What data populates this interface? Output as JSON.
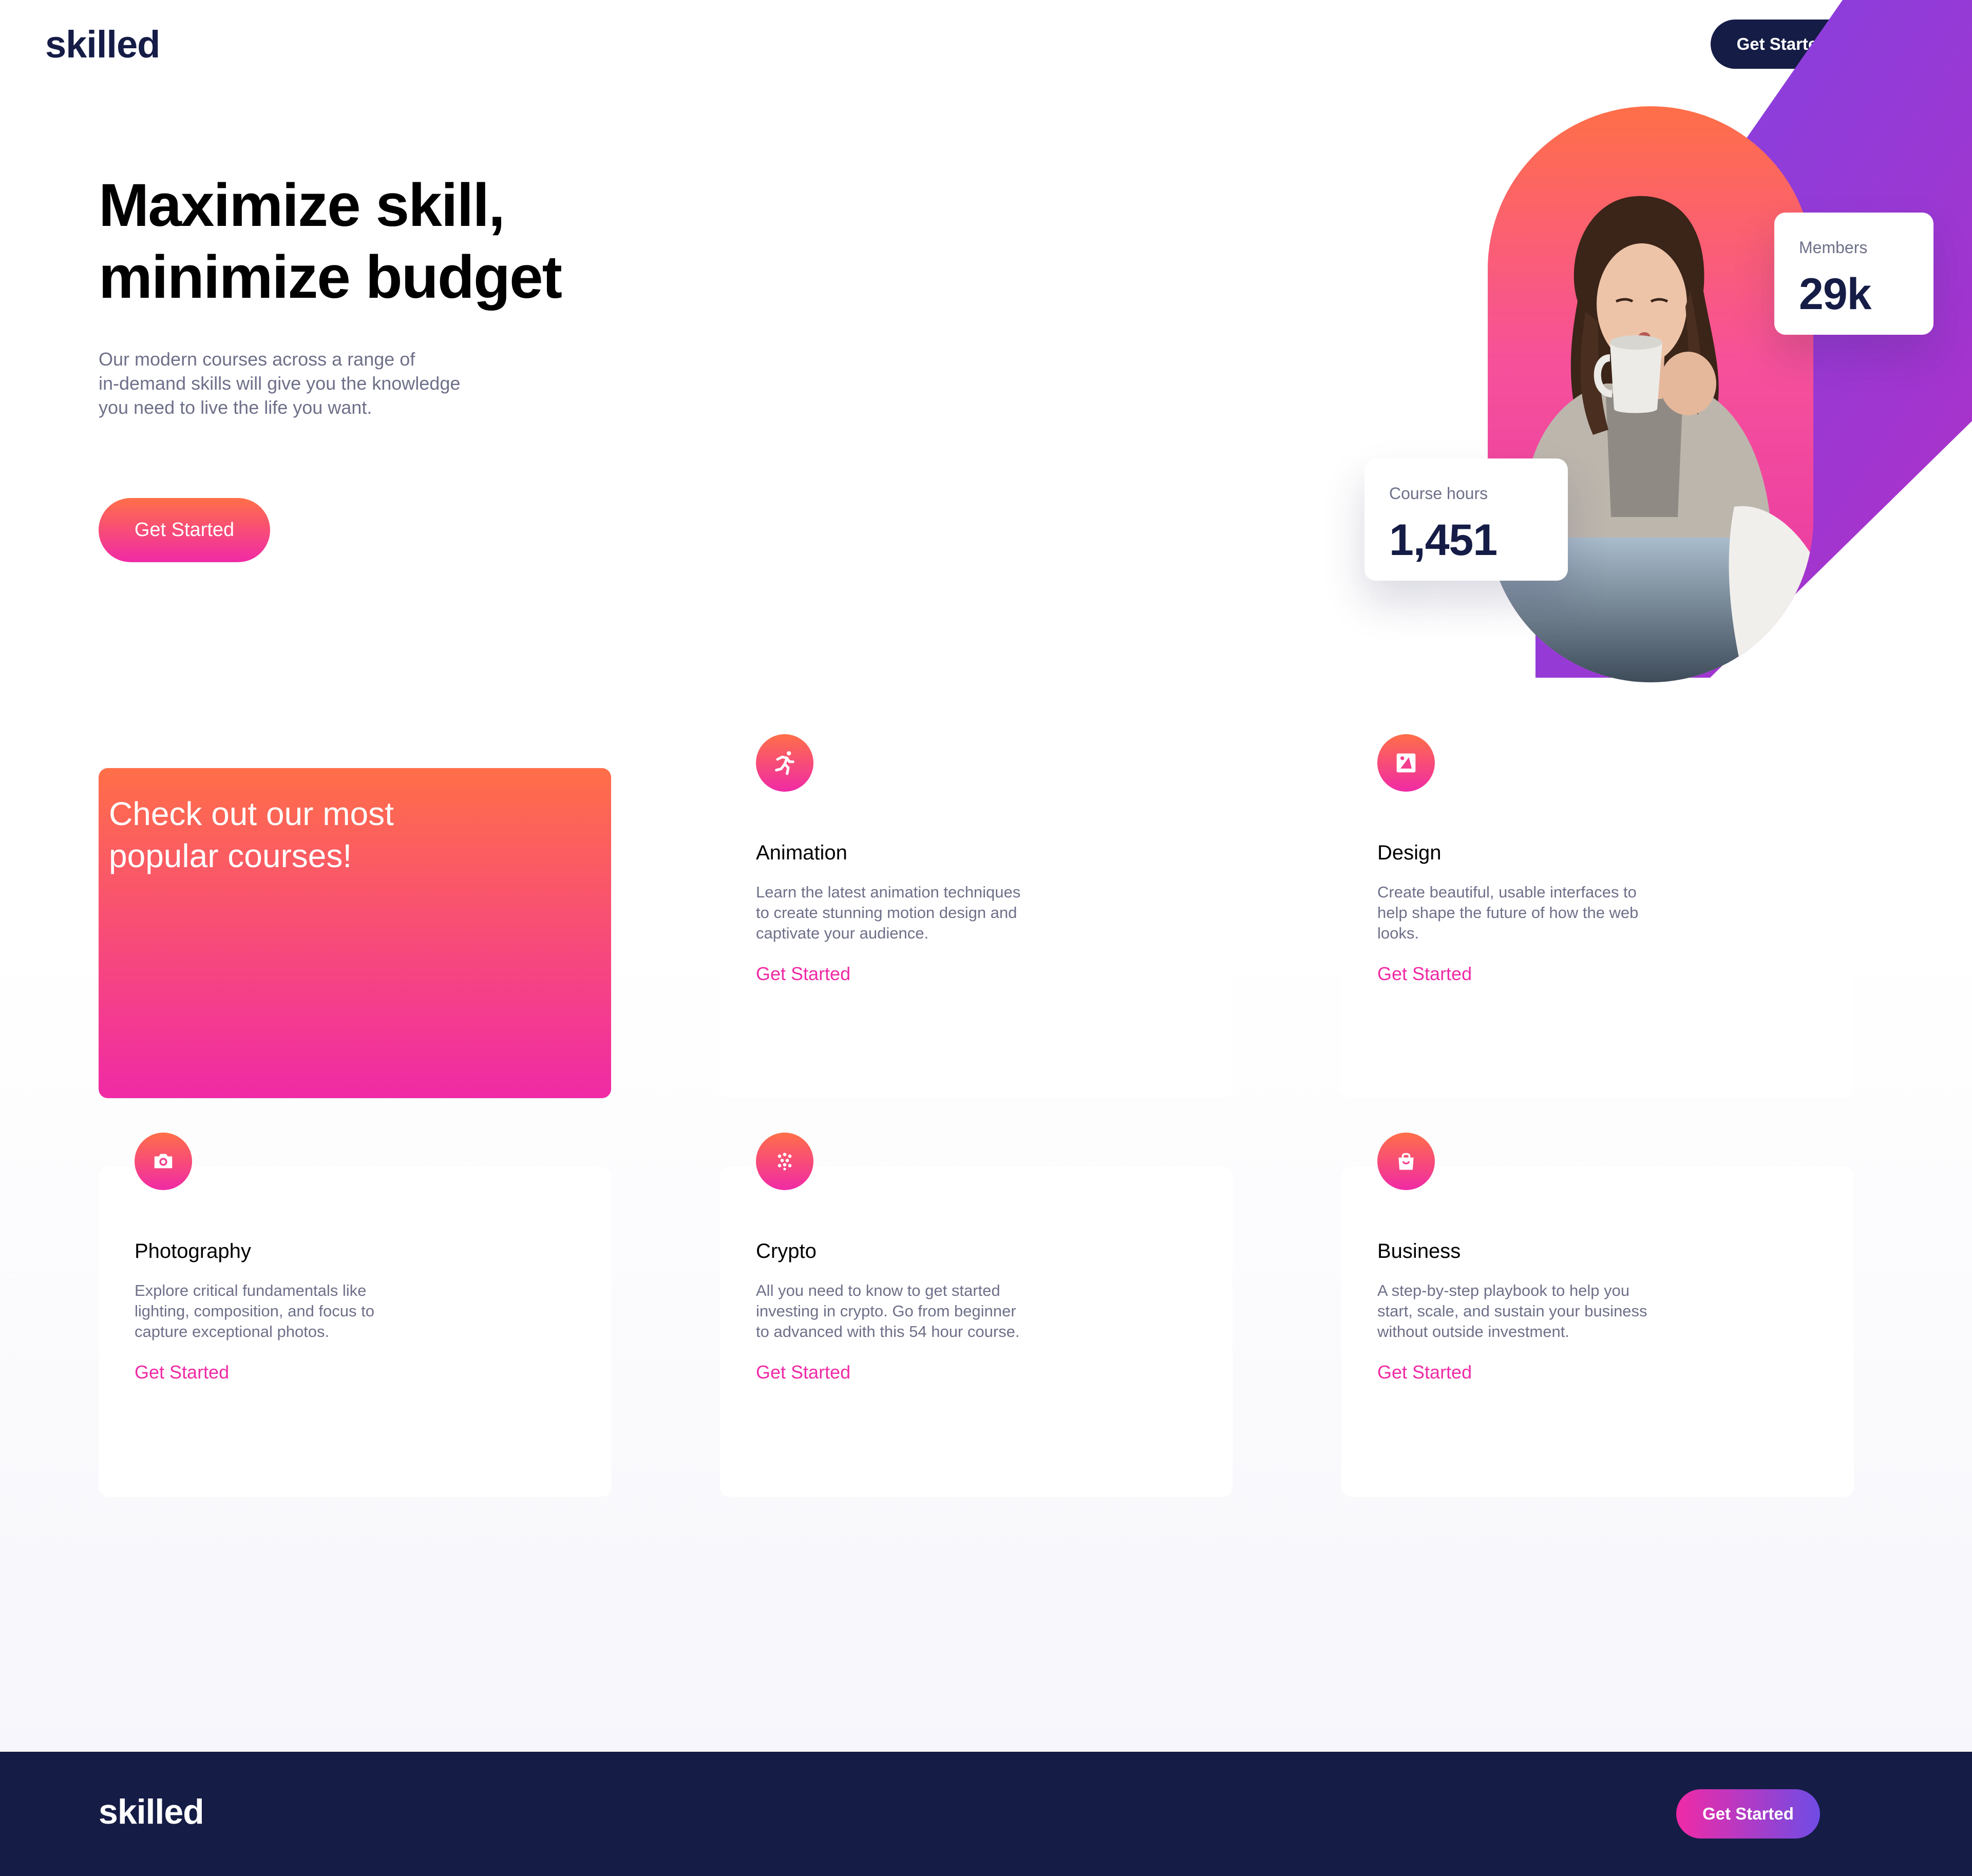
{
  "header": {
    "logo": "skilled",
    "cta_label": "Get Started"
  },
  "hero": {
    "title_lines": [
      "Maximize skill,",
      "minimize budget"
    ],
    "description_lines": [
      "Our modern courses across a range of",
      "in-demand skills will give you the knowledge",
      "you need to live the life you want."
    ],
    "cta_label": "Get Started"
  },
  "stats": {
    "members": {
      "label": "Members",
      "value": "29k"
    },
    "course_hours": {
      "label": "Course hours",
      "value": "1,451"
    }
  },
  "courses": {
    "promo_lines": [
      "Check out our most",
      "popular courses!"
    ],
    "items": [
      {
        "title": "Animation",
        "icon": "running-figure-icon",
        "description_lines": [
          "Learn the latest animation techniques",
          "to create stunning motion design and",
          "captivate your audience."
        ],
        "link_label": "Get Started"
      },
      {
        "title": "Design",
        "icon": "picture-frame-icon",
        "description_lines": [
          "Create beautiful, usable interfaces to",
          "help shape the future of how the web",
          "looks."
        ],
        "link_label": "Get Started"
      },
      {
        "title": "Photography",
        "icon": "camera-icon",
        "description_lines": [
          "Explore critical fundamentals like",
          "lighting, composition, and focus to",
          "capture exceptional photos."
        ],
        "link_label": "Get Started"
      },
      {
        "title": "Crypto",
        "icon": "crypto-dots-icon",
        "description_lines": [
          "All you need to know to get started",
          "investing in crypto. Go from beginner",
          "to advanced with this 54 hour course."
        ],
        "link_label": "Get Started"
      },
      {
        "title": "Business",
        "icon": "shopping-bag-icon",
        "description_lines": [
          "A step-by-step playbook to help you",
          "start, scale, and sustain your business",
          "without outside investment."
        ],
        "link_label": "Get Started"
      }
    ]
  },
  "footer": {
    "logo": "skilled",
    "cta_label": "Get Started"
  },
  "colors": {
    "navy": "#151c46",
    "orange": "#ff6f48",
    "pink": "#f02aa6",
    "purple": "#6f4ce5",
    "grey_text": "#6e7089"
  }
}
